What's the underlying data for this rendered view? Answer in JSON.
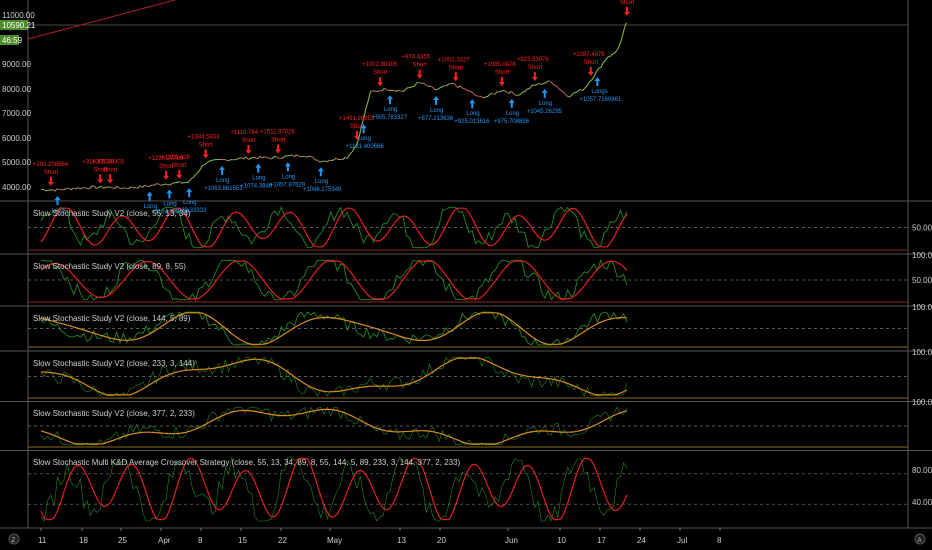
{
  "colors": {
    "background": "#000000",
    "grid": "#3a3a3a",
    "price_up": "#8bc34a",
    "price_down": "#c86464",
    "long": "#2196f3",
    "short": "#ff2020",
    "k_line": "#1f8a1f",
    "d_line": "#e02020",
    "d_line_slow": "#d98c1a",
    "price_badge": "#4c8c2a",
    "trend_line": "#b02020"
  },
  "price_axis": {
    "ticks": [
      "11000.00",
      "9000.00",
      "8000.00",
      "7000.00",
      "6000.00",
      "5000.00",
      "4000.00"
    ],
    "current_price": "10590.21",
    "countdown": "46:59"
  },
  "time_axis": {
    "ticks": [
      "11",
      "18",
      "25",
      "Apr",
      "8",
      "15",
      "22",
      "May",
      "13",
      "20",
      "Jun",
      "10",
      "17",
      "24",
      "Jul",
      "8"
    ]
  },
  "controls": {
    "left_button": "Z",
    "right_button": "A"
  },
  "chart_data": {
    "type": "line",
    "title": "",
    "x_unit": "days since Mar 11",
    "price_series": {
      "x": [
        0,
        5,
        10,
        15,
        20,
        25,
        30,
        33,
        35,
        40,
        45,
        50,
        55,
        60,
        65,
        70,
        75,
        80,
        85,
        88,
        90,
        93,
        96,
        100,
        105,
        110,
        115,
        120,
        125,
        130,
        133,
        136,
        140,
        145,
        150,
        155,
        160,
        165,
        170,
        172,
        174,
        176,
        178
      ],
      "y": [
        3900,
        3880,
        3950,
        3980,
        3990,
        3960,
        4000,
        4050,
        4100,
        4150,
        4200,
        5000,
        5100,
        5150,
        5200,
        5180,
        5250,
        5300,
        5050,
        5100,
        5150,
        5200,
        5750,
        7850,
        8000,
        7900,
        8250,
        7950,
        8200,
        7900,
        7650,
        7700,
        7950,
        7750,
        8150,
        8300,
        7700,
        8000,
        8900,
        9300,
        9400,
        9800,
        10800
      ]
    },
    "ylim": [
      3700,
      11300
    ],
    "signals": [
      {
        "day": 3,
        "type": "short",
        "label": "Short",
        "value": "+292.208884"
      },
      {
        "day": 5,
        "type": "long",
        "label": "Long",
        "value": ""
      },
      {
        "day": 18,
        "type": "short",
        "label": "Short",
        "value": "+318.47088"
      },
      {
        "day": 21,
        "type": "short",
        "label": "Short",
        "value": "+305.30303"
      },
      {
        "day": 33,
        "type": "long",
        "label": "Long",
        "value": ""
      },
      {
        "day": 38,
        "type": "short",
        "label": "Short",
        "value": "+1290.27798"
      },
      {
        "day": 39,
        "type": "long",
        "label": "Long",
        "value": "+1164.023559"
      },
      {
        "day": 42,
        "type": "short",
        "label": "Short",
        "value": "+1391.428"
      },
      {
        "day": 45,
        "type": "long",
        "label": "Long",
        "value": "+1083.33333"
      },
      {
        "day": 50,
        "type": "short",
        "label": "Short",
        "value": "+1384.5833"
      },
      {
        "day": 55,
        "type": "long",
        "label": "Long",
        "value": "+1063.861553"
      },
      {
        "day": 63,
        "type": "short",
        "label": "Short",
        "value": "+1110.784"
      },
      {
        "day": 66,
        "type": "long",
        "label": "Long",
        "value": "+1074.3846"
      },
      {
        "day": 72,
        "type": "short",
        "label": "Short",
        "value": "+1511.97026"
      },
      {
        "day": 75,
        "type": "long",
        "label": "Long",
        "value": "+1057.87629"
      },
      {
        "day": 85,
        "type": "long",
        "label": "Long",
        "value": "+1086.175349"
      },
      {
        "day": 96,
        "type": "short",
        "label": "Short",
        "value": "+1491.26953"
      },
      {
        "day": 98,
        "type": "long",
        "label": "Long",
        "value": "+1131.400666"
      },
      {
        "day": 103,
        "type": "short",
        "label": "Short",
        "value": "+1002.98305"
      },
      {
        "day": 106,
        "type": "long",
        "label": "Long",
        "value": "+905.783327"
      },
      {
        "day": 115,
        "type": "short",
        "label": "Short",
        "value": "+974.4355"
      },
      {
        "day": 120,
        "type": "long",
        "label": "Long",
        "value": "+877.213636"
      },
      {
        "day": 126,
        "type": "short",
        "label": "Short",
        "value": "+1002.3327"
      },
      {
        "day": 131,
        "type": "long",
        "label": "Long",
        "value": "+925.013616"
      },
      {
        "day": 140,
        "type": "short",
        "label": "Short",
        "value": "+1085.0078"
      },
      {
        "day": 143,
        "type": "long",
        "label": "Long",
        "value": "+975.708896"
      },
      {
        "day": 150,
        "type": "short",
        "label": "Short",
        "value": "+823.53076"
      },
      {
        "day": 153,
        "type": "long",
        "label": "Long",
        "value": "+1045.26295"
      },
      {
        "day": 167,
        "type": "short",
        "label": "Short",
        "value": "+1087.4978"
      },
      {
        "day": 169,
        "type": "long",
        "label": "Longs",
        "value": "+1057.7160861"
      },
      {
        "day": 178,
        "type": "short",
        "label": "Short",
        "value": ""
      }
    ]
  },
  "panes": [
    {
      "title": "Slow Stochastic Study V2 (close, 55, 13, 34)",
      "ticks": [
        "50.00"
      ],
      "params": [
        55,
        13,
        34
      ]
    },
    {
      "title": "Slow Stochastic Study V2 (close, 89, 8, 55)",
      "ticks": [
        "100.00",
        "50.00"
      ],
      "params": [
        89,
        8,
        55
      ]
    },
    {
      "title": "Slow Stochastic Study V2 (close, 144, 5, 89)",
      "ticks": [
        "100.00"
      ],
      "params": [
        144,
        5,
        89
      ]
    },
    {
      "title": "Slow Stochastic Study V2 (close, 233, 3, 144)",
      "ticks": [
        "100.00"
      ],
      "params": [
        233,
        3,
        144
      ]
    },
    {
      "title": "Slow Stochastic Study V2 (close, 377, 2, 233)",
      "ticks": [
        "100.00"
      ],
      "params": [
        377,
        2,
        233
      ]
    },
    {
      "title": "Slow Stochastic Multi K&D Average Crossover Strategy (close, 55, 13, 34, 89, 8, 55, 144, 5, 89, 233, 3, 144, 377, 2, 233)",
      "ticks": [
        "80.00",
        "40.00"
      ],
      "params": [
        55,
        13,
        34
      ]
    }
  ]
}
